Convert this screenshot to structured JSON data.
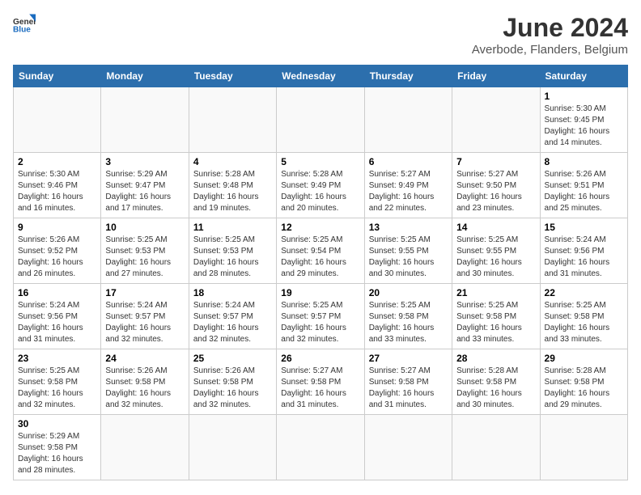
{
  "logo": {
    "line1": "General",
    "line2": "Blue"
  },
  "title": "June 2024",
  "subtitle": "Averbode, Flanders, Belgium",
  "weekdays": [
    "Sunday",
    "Monday",
    "Tuesday",
    "Wednesday",
    "Thursday",
    "Friday",
    "Saturday"
  ],
  "weeks": [
    [
      {
        "day": "",
        "info": ""
      },
      {
        "day": "",
        "info": ""
      },
      {
        "day": "",
        "info": ""
      },
      {
        "day": "",
        "info": ""
      },
      {
        "day": "",
        "info": ""
      },
      {
        "day": "",
        "info": ""
      },
      {
        "day": "1",
        "info": "Sunrise: 5:30 AM\nSunset: 9:45 PM\nDaylight: 16 hours\nand 14 minutes."
      }
    ],
    [
      {
        "day": "2",
        "info": "Sunrise: 5:30 AM\nSunset: 9:46 PM\nDaylight: 16 hours\nand 16 minutes."
      },
      {
        "day": "3",
        "info": "Sunrise: 5:29 AM\nSunset: 9:47 PM\nDaylight: 16 hours\nand 17 minutes."
      },
      {
        "day": "4",
        "info": "Sunrise: 5:28 AM\nSunset: 9:48 PM\nDaylight: 16 hours\nand 19 minutes."
      },
      {
        "day": "5",
        "info": "Sunrise: 5:28 AM\nSunset: 9:49 PM\nDaylight: 16 hours\nand 20 minutes."
      },
      {
        "day": "6",
        "info": "Sunrise: 5:27 AM\nSunset: 9:49 PM\nDaylight: 16 hours\nand 22 minutes."
      },
      {
        "day": "7",
        "info": "Sunrise: 5:27 AM\nSunset: 9:50 PM\nDaylight: 16 hours\nand 23 minutes."
      },
      {
        "day": "8",
        "info": "Sunrise: 5:26 AM\nSunset: 9:51 PM\nDaylight: 16 hours\nand 25 minutes."
      }
    ],
    [
      {
        "day": "9",
        "info": "Sunrise: 5:26 AM\nSunset: 9:52 PM\nDaylight: 16 hours\nand 26 minutes."
      },
      {
        "day": "10",
        "info": "Sunrise: 5:25 AM\nSunset: 9:53 PM\nDaylight: 16 hours\nand 27 minutes."
      },
      {
        "day": "11",
        "info": "Sunrise: 5:25 AM\nSunset: 9:53 PM\nDaylight: 16 hours\nand 28 minutes."
      },
      {
        "day": "12",
        "info": "Sunrise: 5:25 AM\nSunset: 9:54 PM\nDaylight: 16 hours\nand 29 minutes."
      },
      {
        "day": "13",
        "info": "Sunrise: 5:25 AM\nSunset: 9:55 PM\nDaylight: 16 hours\nand 30 minutes."
      },
      {
        "day": "14",
        "info": "Sunrise: 5:25 AM\nSunset: 9:55 PM\nDaylight: 16 hours\nand 30 minutes."
      },
      {
        "day": "15",
        "info": "Sunrise: 5:24 AM\nSunset: 9:56 PM\nDaylight: 16 hours\nand 31 minutes."
      }
    ],
    [
      {
        "day": "16",
        "info": "Sunrise: 5:24 AM\nSunset: 9:56 PM\nDaylight: 16 hours\nand 31 minutes."
      },
      {
        "day": "17",
        "info": "Sunrise: 5:24 AM\nSunset: 9:57 PM\nDaylight: 16 hours\nand 32 minutes."
      },
      {
        "day": "18",
        "info": "Sunrise: 5:24 AM\nSunset: 9:57 PM\nDaylight: 16 hours\nand 32 minutes."
      },
      {
        "day": "19",
        "info": "Sunrise: 5:25 AM\nSunset: 9:57 PM\nDaylight: 16 hours\nand 32 minutes."
      },
      {
        "day": "20",
        "info": "Sunrise: 5:25 AM\nSunset: 9:58 PM\nDaylight: 16 hours\nand 33 minutes."
      },
      {
        "day": "21",
        "info": "Sunrise: 5:25 AM\nSunset: 9:58 PM\nDaylight: 16 hours\nand 33 minutes."
      },
      {
        "day": "22",
        "info": "Sunrise: 5:25 AM\nSunset: 9:58 PM\nDaylight: 16 hours\nand 33 minutes."
      }
    ],
    [
      {
        "day": "23",
        "info": "Sunrise: 5:25 AM\nSunset: 9:58 PM\nDaylight: 16 hours\nand 32 minutes."
      },
      {
        "day": "24",
        "info": "Sunrise: 5:26 AM\nSunset: 9:58 PM\nDaylight: 16 hours\nand 32 minutes."
      },
      {
        "day": "25",
        "info": "Sunrise: 5:26 AM\nSunset: 9:58 PM\nDaylight: 16 hours\nand 32 minutes."
      },
      {
        "day": "26",
        "info": "Sunrise: 5:27 AM\nSunset: 9:58 PM\nDaylight: 16 hours\nand 31 minutes."
      },
      {
        "day": "27",
        "info": "Sunrise: 5:27 AM\nSunset: 9:58 PM\nDaylight: 16 hours\nand 31 minutes."
      },
      {
        "day": "28",
        "info": "Sunrise: 5:28 AM\nSunset: 9:58 PM\nDaylight: 16 hours\nand 30 minutes."
      },
      {
        "day": "29",
        "info": "Sunrise: 5:28 AM\nSunset: 9:58 PM\nDaylight: 16 hours\nand 29 minutes."
      }
    ],
    [
      {
        "day": "30",
        "info": "Sunrise: 5:29 AM\nSunset: 9:58 PM\nDaylight: 16 hours\nand 28 minutes."
      },
      {
        "day": "",
        "info": ""
      },
      {
        "day": "",
        "info": ""
      },
      {
        "day": "",
        "info": ""
      },
      {
        "day": "",
        "info": ""
      },
      {
        "day": "",
        "info": ""
      },
      {
        "day": "",
        "info": ""
      }
    ]
  ]
}
